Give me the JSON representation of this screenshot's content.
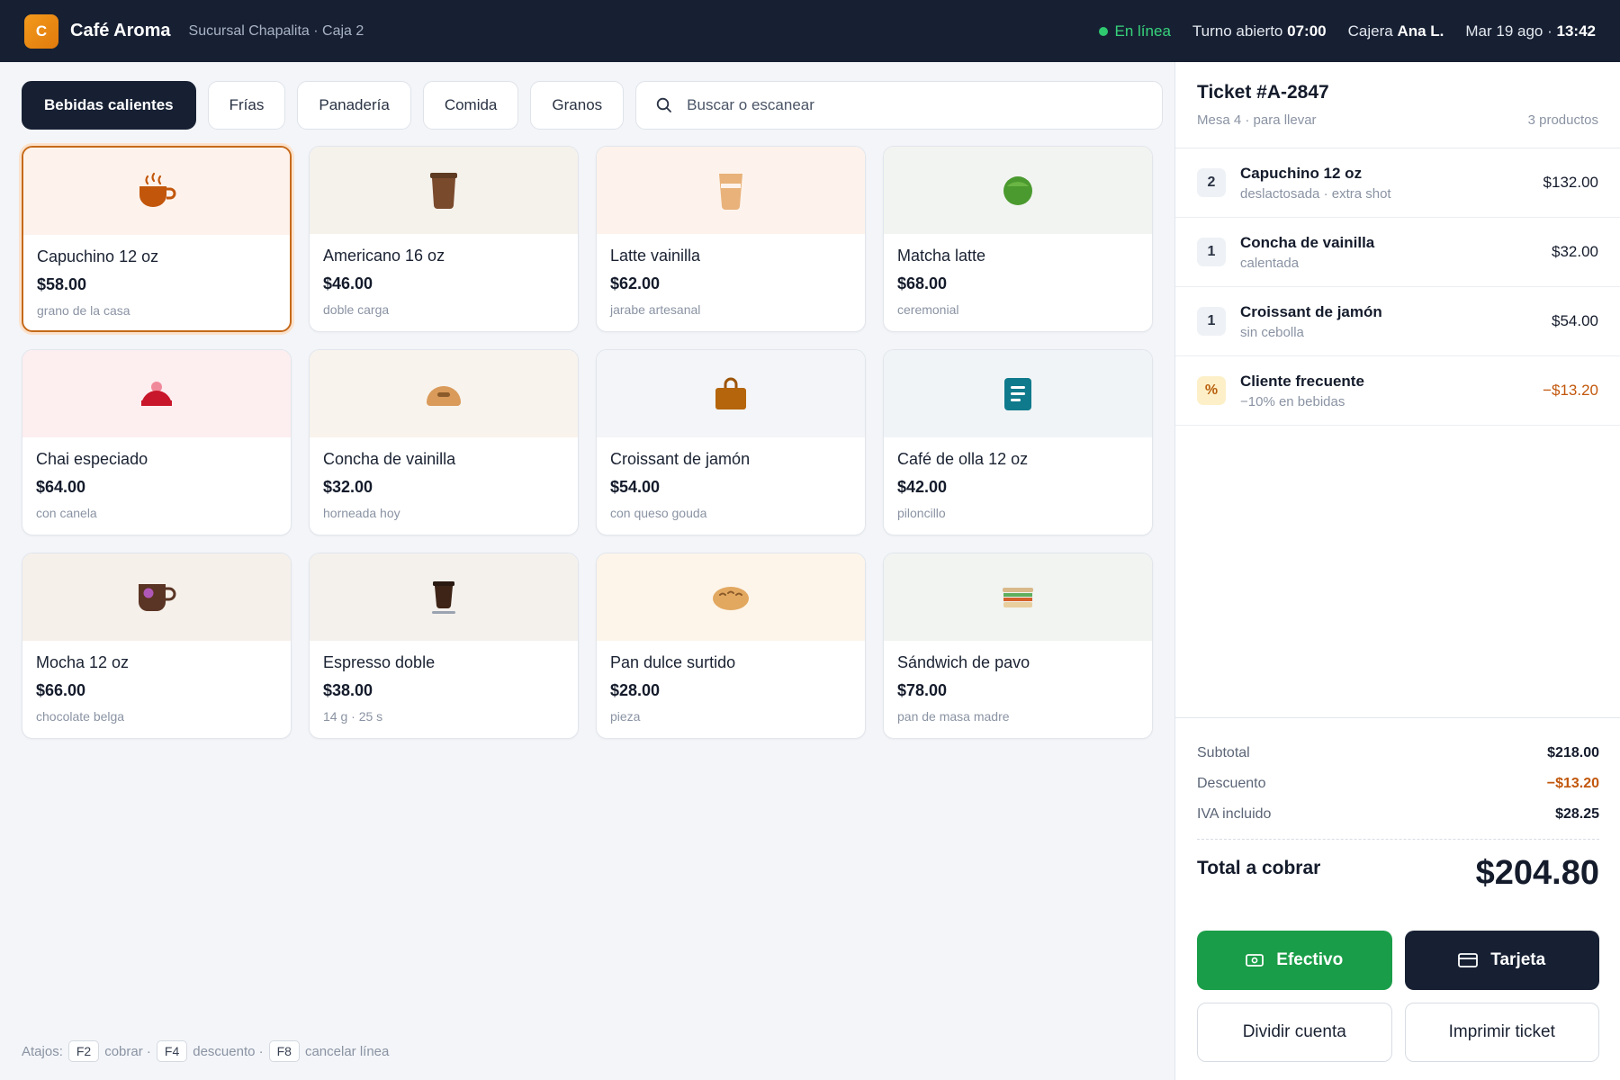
{
  "header": {
    "logo_letter": "C",
    "app_name": "Café Aroma",
    "branch": "Sucursal Chapalita · Caja 2",
    "status": "En línea",
    "shift_label": "Turno abierto",
    "shift_time": "07:00",
    "cashier_label": "Cajera",
    "cashier_name": "Ana L.",
    "date": "Mar 19 ago ·",
    "time": "13:42"
  },
  "categories": [
    {
      "label": "Bebidas calientes",
      "active": true
    },
    {
      "label": "Frías",
      "active": false
    },
    {
      "label": "Panadería",
      "active": false
    },
    {
      "label": "Comida",
      "active": false
    },
    {
      "label": "Granos",
      "active": false
    }
  ],
  "search": {
    "placeholder": "Buscar o escanear",
    "value": ""
  },
  "products": [
    {
      "name": "Capuchino 12 oz",
      "price": "$58.00",
      "note": "grano de la casa",
      "icon": "hot-cup-icon",
      "selected": true
    },
    {
      "name": "Americano 16 oz",
      "price": "$46.00",
      "note": "doble carga",
      "icon": "coffee-tumbler-icon",
      "selected": false
    },
    {
      "name": "Latte vainilla",
      "price": "$62.00",
      "note": "jarabe artesanal",
      "icon": "latte-glass-icon",
      "selected": false
    },
    {
      "name": "Matcha latte",
      "price": "$68.00",
      "note": "ceremonial",
      "icon": "matcha-bowl-icon",
      "selected": false
    },
    {
      "name": "Chai especiado",
      "price": "$64.00",
      "note": "con canela",
      "icon": "cupcake-icon",
      "selected": false
    },
    {
      "name": "Concha de vainilla",
      "price": "$32.00",
      "note": "horneada hoy",
      "icon": "bread-bun-icon",
      "selected": false
    },
    {
      "name": "Croissant de jamón",
      "price": "$54.00",
      "note": "con queso gouda",
      "icon": "bag-icon",
      "selected": false
    },
    {
      "name": "Café de olla 12 oz",
      "price": "$42.00",
      "note": "piloncillo",
      "icon": "note-card-icon",
      "selected": false
    },
    {
      "name": "Mocha 12 oz",
      "price": "$66.00",
      "note": "chocolate belga",
      "icon": "mocha-mug-icon",
      "selected": false
    },
    {
      "name": "Espresso doble",
      "price": "$38.00",
      "note": "14 g · 25 s",
      "icon": "espresso-cup-icon",
      "selected": false
    },
    {
      "name": "Pan dulce surtido",
      "price": "$28.00",
      "note": "pieza",
      "icon": "sweet-bread-icon",
      "selected": false
    },
    {
      "name": "Sándwich de pavo",
      "price": "$78.00",
      "note": "pan de masa madre",
      "icon": "sandwich-icon",
      "selected": false
    }
  ],
  "shortcuts": {
    "label": "Atajos:",
    "items": [
      {
        "key": "F2",
        "action": "cobrar ·"
      },
      {
        "key": "F4",
        "action": "descuento ·"
      },
      {
        "key": "F8",
        "action": "cancelar línea"
      }
    ]
  },
  "ticket": {
    "title": "Ticket #A-2847",
    "subtitle": "Mesa 4 · para llevar",
    "count": "3 productos",
    "lines": [
      {
        "qty": "2",
        "name": "Capuchino 12 oz",
        "mods": "deslactosada · extra shot",
        "amount": "$132.00",
        "discount": false
      },
      {
        "qty": "1",
        "name": "Concha de vainilla",
        "mods": "calentada",
        "amount": "$32.00",
        "discount": false
      },
      {
        "qty": "1",
        "name": "Croissant de jamón",
        "mods": "sin cebolla",
        "amount": "$54.00",
        "discount": false
      },
      {
        "qty": "%",
        "name": "Cliente frecuente",
        "mods": "−10% en bebidas",
        "amount": "−$13.20",
        "discount": true
      }
    ],
    "subtotal_label": "Subtotal",
    "subtotal": "$218.00",
    "discount_label": "Descuento",
    "discount": "−$13.20",
    "tax_label": "IVA incluido",
    "tax": "$28.25",
    "total_label": "Total a cobrar",
    "total": "$204.80"
  },
  "actions": {
    "cash": "Efectivo",
    "card": "Tarjeta",
    "split": "Dividir cuenta",
    "print": "Imprimir ticket"
  },
  "colors": {
    "topbar": "#172033",
    "accent_orange": "#c66a1a",
    "cash_green": "#1a9d48",
    "online_green": "#2fc96f",
    "discount": "#c2570c"
  }
}
